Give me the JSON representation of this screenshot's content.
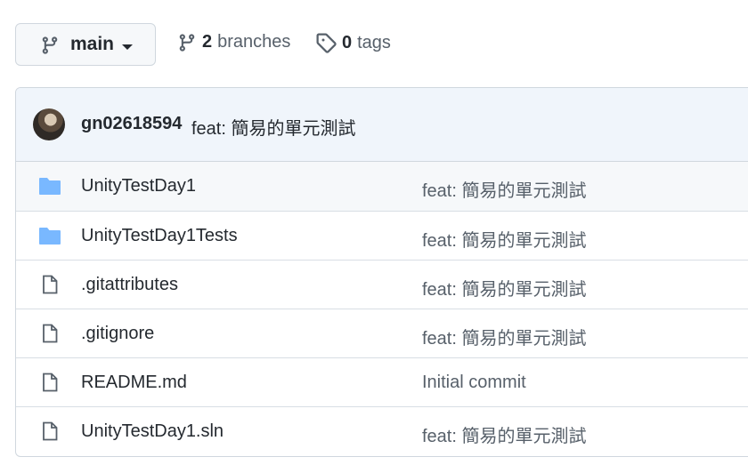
{
  "branch": {
    "name": "main"
  },
  "meta": {
    "branches_count": "2",
    "branches_label": "branches",
    "tags_count": "0",
    "tags_label": "tags"
  },
  "latest_commit": {
    "author": "gn02618594",
    "message": "feat: 簡易的單元測試"
  },
  "files": [
    {
      "type": "folder",
      "name": "UnityTestDay1",
      "commit": "feat: 簡易的單元測試"
    },
    {
      "type": "folder",
      "name": "UnityTestDay1Tests",
      "commit": "feat: 簡易的單元測試"
    },
    {
      "type": "file",
      "name": ".gitattributes",
      "commit": "feat: 簡易的單元測試"
    },
    {
      "type": "file",
      "name": ".gitignore",
      "commit": "feat: 簡易的單元測試"
    },
    {
      "type": "file",
      "name": "README.md",
      "commit": "Initial commit"
    },
    {
      "type": "file",
      "name": "UnityTestDay1.sln",
      "commit": "feat: 簡易的單元測試"
    }
  ],
  "colors": {
    "folder": "#79b8ff",
    "file_icon": "#57606a",
    "header_bg": "#f0f5fb"
  }
}
